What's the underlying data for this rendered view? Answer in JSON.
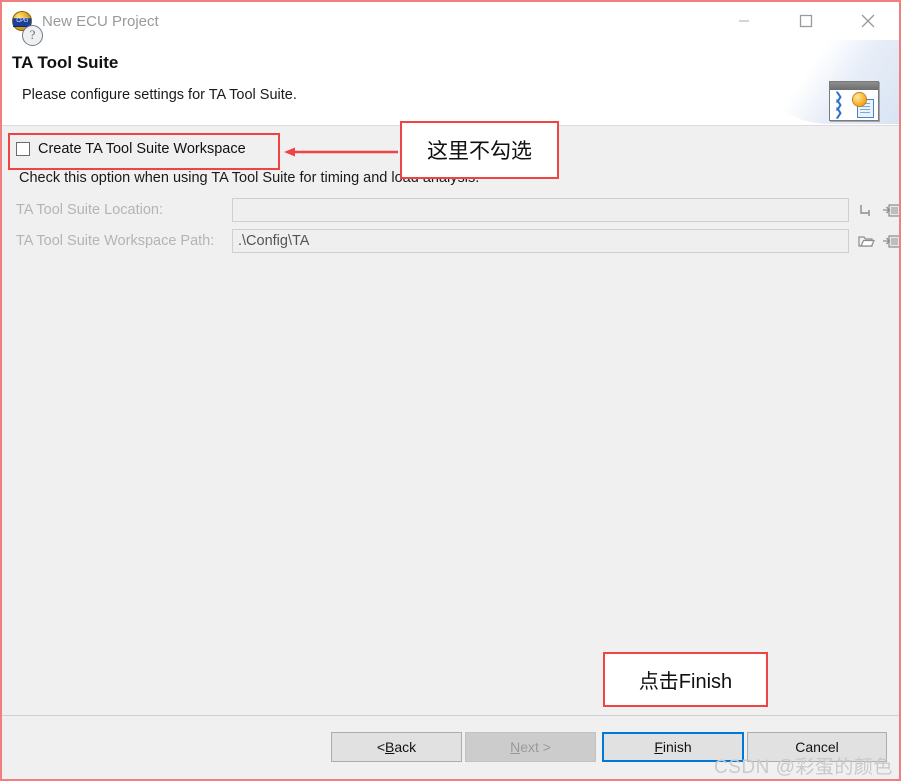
{
  "window": {
    "title": "New ECU Project",
    "app_icon": "ecu-project-icon",
    "controls": {
      "minimize": "minimize-icon",
      "maximize": "maximize-icon",
      "close": "close-icon"
    }
  },
  "header": {
    "title": "TA Tool Suite",
    "subtitle": "Please configure settings for TA Tool Suite.",
    "banner_icon": "wizard-banner-icon"
  },
  "form": {
    "checkbox": {
      "label": "Create TA Tool Suite Workspace",
      "checked": false
    },
    "description": "Check this option when using TA Tool Suite for timing and load analysis.",
    "fields": [
      {
        "label": "TA Tool Suite Location:",
        "value": "",
        "disabled": true,
        "buttons": [
          "browse-variable-icon",
          "browse-import-icon"
        ]
      },
      {
        "label": "TA Tool Suite Workspace Path:",
        "value": ".\\Config\\TA",
        "disabled": true,
        "buttons": [
          "browse-folder-icon",
          "browse-import-icon"
        ]
      }
    ]
  },
  "footer": {
    "help_icon": "help-question-icon",
    "buttons": [
      {
        "id": "back",
        "prefix": "< ",
        "mnemonic": "B",
        "rest": "ack",
        "disabled": false,
        "focused": false
      },
      {
        "id": "next",
        "prefix": "",
        "mnemonic": "N",
        "rest": "ext >",
        "disabled": true,
        "focused": false
      },
      {
        "id": "finish",
        "prefix": "",
        "mnemonic": "F",
        "rest": "inish",
        "disabled": false,
        "focused": true
      },
      {
        "id": "cancel",
        "prefix": "",
        "mnemonic": "C",
        "rest": "ancel",
        "disabled": false,
        "focused": false
      }
    ]
  },
  "annotations": {
    "checkbox_note": "这里不勾选",
    "finish_note": "点击Finish",
    "color": "#ef4444"
  },
  "watermark": "CSDN @彩蛋的颜色"
}
